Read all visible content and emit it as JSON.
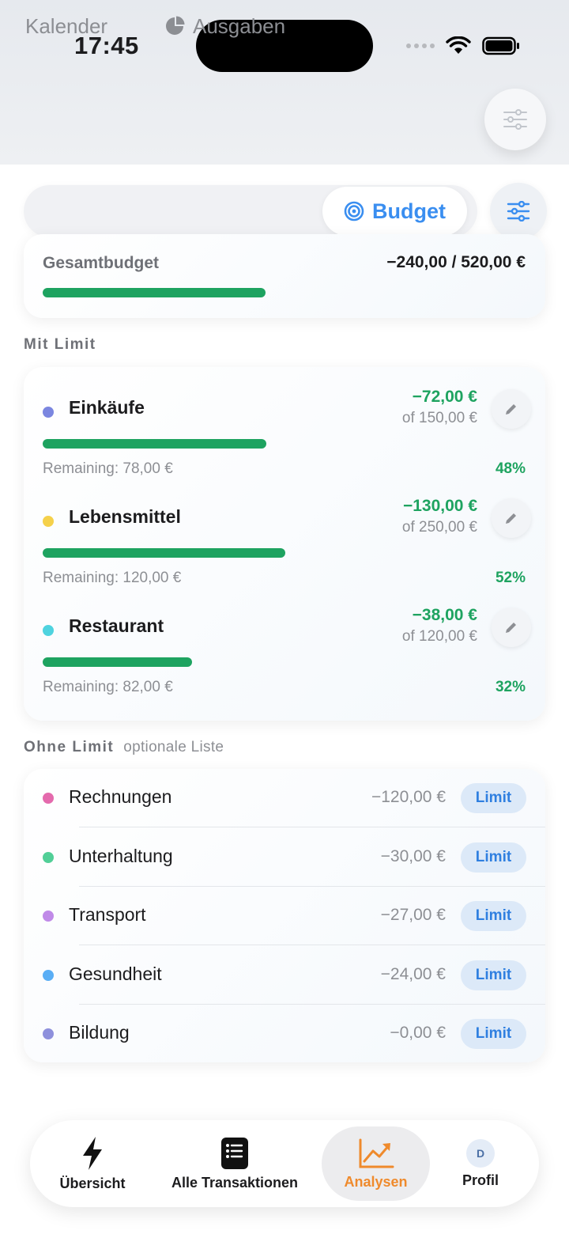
{
  "status": {
    "time": "17:45"
  },
  "segments": {
    "calendar": "Kalender",
    "expenses": "Ausgaben",
    "budget": "Budget"
  },
  "total": {
    "label": "Gesamtbudget",
    "value": "−240,00 / 520,00 €",
    "progress": 0.46
  },
  "with_limit": {
    "title": "Mit Limit",
    "items": [
      {
        "name": "Einkäufe",
        "color": "#7b86e0",
        "amount": "−72,00 €",
        "of": "of 150,00 €",
        "remaining": "Remaining: 78,00 €",
        "percent": "48%",
        "progress": 0.48
      },
      {
        "name": "Lebensmittel",
        "color": "#f5d14a",
        "amount": "−130,00 €",
        "of": "of 250,00 €",
        "remaining": "Remaining: 120,00 €",
        "percent": "52%",
        "progress": 0.52
      },
      {
        "name": "Restaurant",
        "color": "#4fd3df",
        "amount": "−38,00 €",
        "of": "of 120,00 €",
        "remaining": "Remaining: 82,00 €",
        "percent": "32%",
        "progress": 0.32
      }
    ]
  },
  "without_limit": {
    "title": "Ohne Limit",
    "subtitle": "optionale Liste",
    "button_label": "Limit",
    "items": [
      {
        "name": "Rechnungen",
        "color": "#e46aad",
        "amount": "−120,00 €"
      },
      {
        "name": "Unterhaltung",
        "color": "#52cf97",
        "amount": "−30,00 €"
      },
      {
        "name": "Transport",
        "color": "#c08ae8",
        "amount": "−27,00 €"
      },
      {
        "name": "Gesundheit",
        "color": "#5aaef5",
        "amount": "−24,00 €"
      },
      {
        "name": "Bildung",
        "color": "#8e90dc",
        "amount": "−0,00 €"
      }
    ]
  },
  "tabbar": {
    "overview": "Übersicht",
    "transactions": "Alle Transaktionen",
    "analytics": "Analysen",
    "profile": "Profil",
    "avatar_initial": "D"
  },
  "colors": {
    "accent": "#3a8ef0",
    "progress": "#1ea360",
    "active_tab": "#ef8a2c"
  }
}
